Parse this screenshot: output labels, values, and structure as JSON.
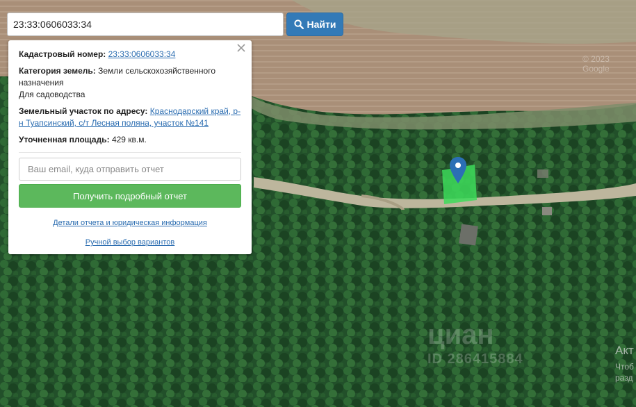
{
  "search": {
    "value": "23:33:0606033:34",
    "button_label": "Найти",
    "button_icon": "search-icon"
  },
  "info_panel": {
    "cadastral_label": "Кадастровый номер:",
    "cadastral_value": "23:33:0606033:34",
    "category_label": "Категория земель:",
    "category_value": "Земли сельскохозяйственного назначения",
    "usage_value": "Для садоводства",
    "address_label": "Земельный участок по адресу:",
    "address_value": "Краснодарский край, р-н Туапсинский, с/т Лесная поляна, участок №141",
    "area_label": "Уточненная площадь:",
    "area_value": "429 кв.м.",
    "email_placeholder": "Ваш email, куда отправить отчет",
    "report_button": "Получить подробный отчет",
    "details_link": "Детали отчета и юридическая информация",
    "manual_link": "Ручной выбор вариантов",
    "close_icon": "close-icon"
  },
  "map": {
    "copyright": "© 2023 Google",
    "watermark_brand": "циан",
    "watermark_id": "ID 286415884",
    "activation_title": "Акт",
    "activation_line2": "Чтоб",
    "activation_line3": "разд",
    "marker_icon": "map-pin-icon",
    "parcel_color": "#3ddc5a"
  },
  "colors": {
    "primary_button": "#337ab7",
    "success_button": "#5cb85c",
    "link": "#2a6cb0"
  }
}
